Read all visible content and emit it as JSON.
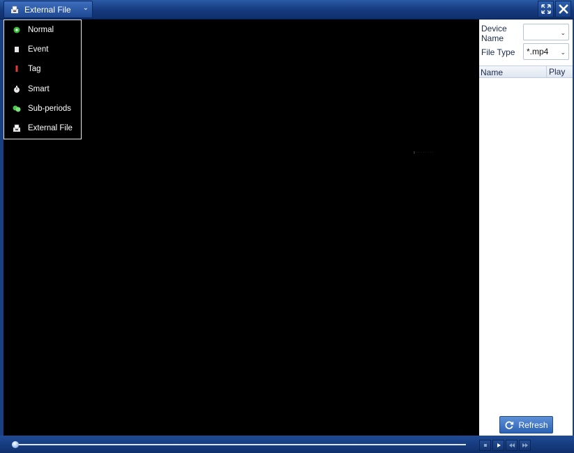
{
  "titlebar": {
    "mode_select_label": "External File",
    "mode_icon": "external-file-icon",
    "fullscreen_icon": "fullscreen-icon",
    "close_icon": "close-icon"
  },
  "dropdown": {
    "items": [
      {
        "label": "Normal",
        "icon": "normal-icon",
        "color": "#3cbf3c"
      },
      {
        "label": "Event",
        "icon": "event-icon",
        "color": "#e8e8e8"
      },
      {
        "label": "Tag",
        "icon": "tag-icon",
        "color": "#e23b3b"
      },
      {
        "label": "Smart",
        "icon": "smart-icon",
        "color": "#e8e8e8"
      },
      {
        "label": "Sub-periods",
        "icon": "sub-periods-icon",
        "color": "#48c84a"
      },
      {
        "label": "External File",
        "icon": "external-file-icon",
        "color": "#e8e8e8"
      }
    ]
  },
  "side_panel": {
    "device_name_label_line1": "Device",
    "device_name_label_line2": "Name",
    "device_name_value": "",
    "file_type_label": "File Type",
    "file_type_value": "*.mp4",
    "table": {
      "columns": [
        "Name",
        "Play"
      ],
      "rows": []
    },
    "refresh_label": "Refresh"
  },
  "playback": {
    "progress": 0.0,
    "controls": [
      "stop",
      "play",
      "rewind",
      "fast-forward"
    ]
  },
  "colors": {
    "frame_blue": "#1b3f83",
    "video_bg": "#000000",
    "button_blue": "#2c62b2"
  }
}
